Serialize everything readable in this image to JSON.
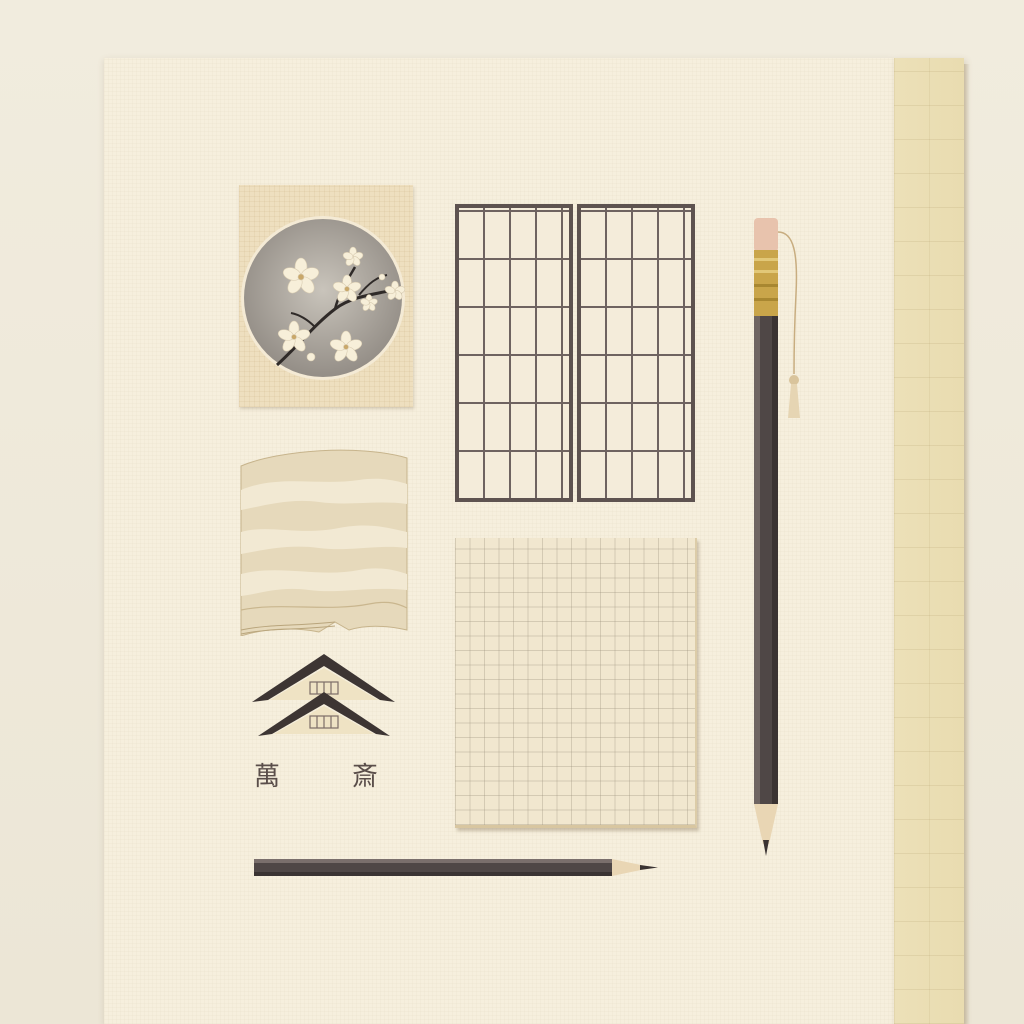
{
  "scene": {
    "description_colors": {
      "background": "#efeadb",
      "paper": "#f6efdd",
      "strip": "#e9dcb0",
      "ink": "#5e5350",
      "blossom_circle": "#a8a39b",
      "blossom_petal": "#f6ecd6",
      "pencil_body": "#4f4746",
      "ferrule": "#c9a54a",
      "eraser": "#e8c3ad"
    }
  },
  "icons": {
    "blossom": "cherry-blossom-icon",
    "shoji": "shoji-screen-icon",
    "waves": "wave-pattern-icon",
    "grid": "grid-paper-icon",
    "roof": "pagoda-roof-icon",
    "pencil": "pencil-icon"
  },
  "labels": {
    "glyph_left": "萬",
    "glyph_right": "斎"
  }
}
